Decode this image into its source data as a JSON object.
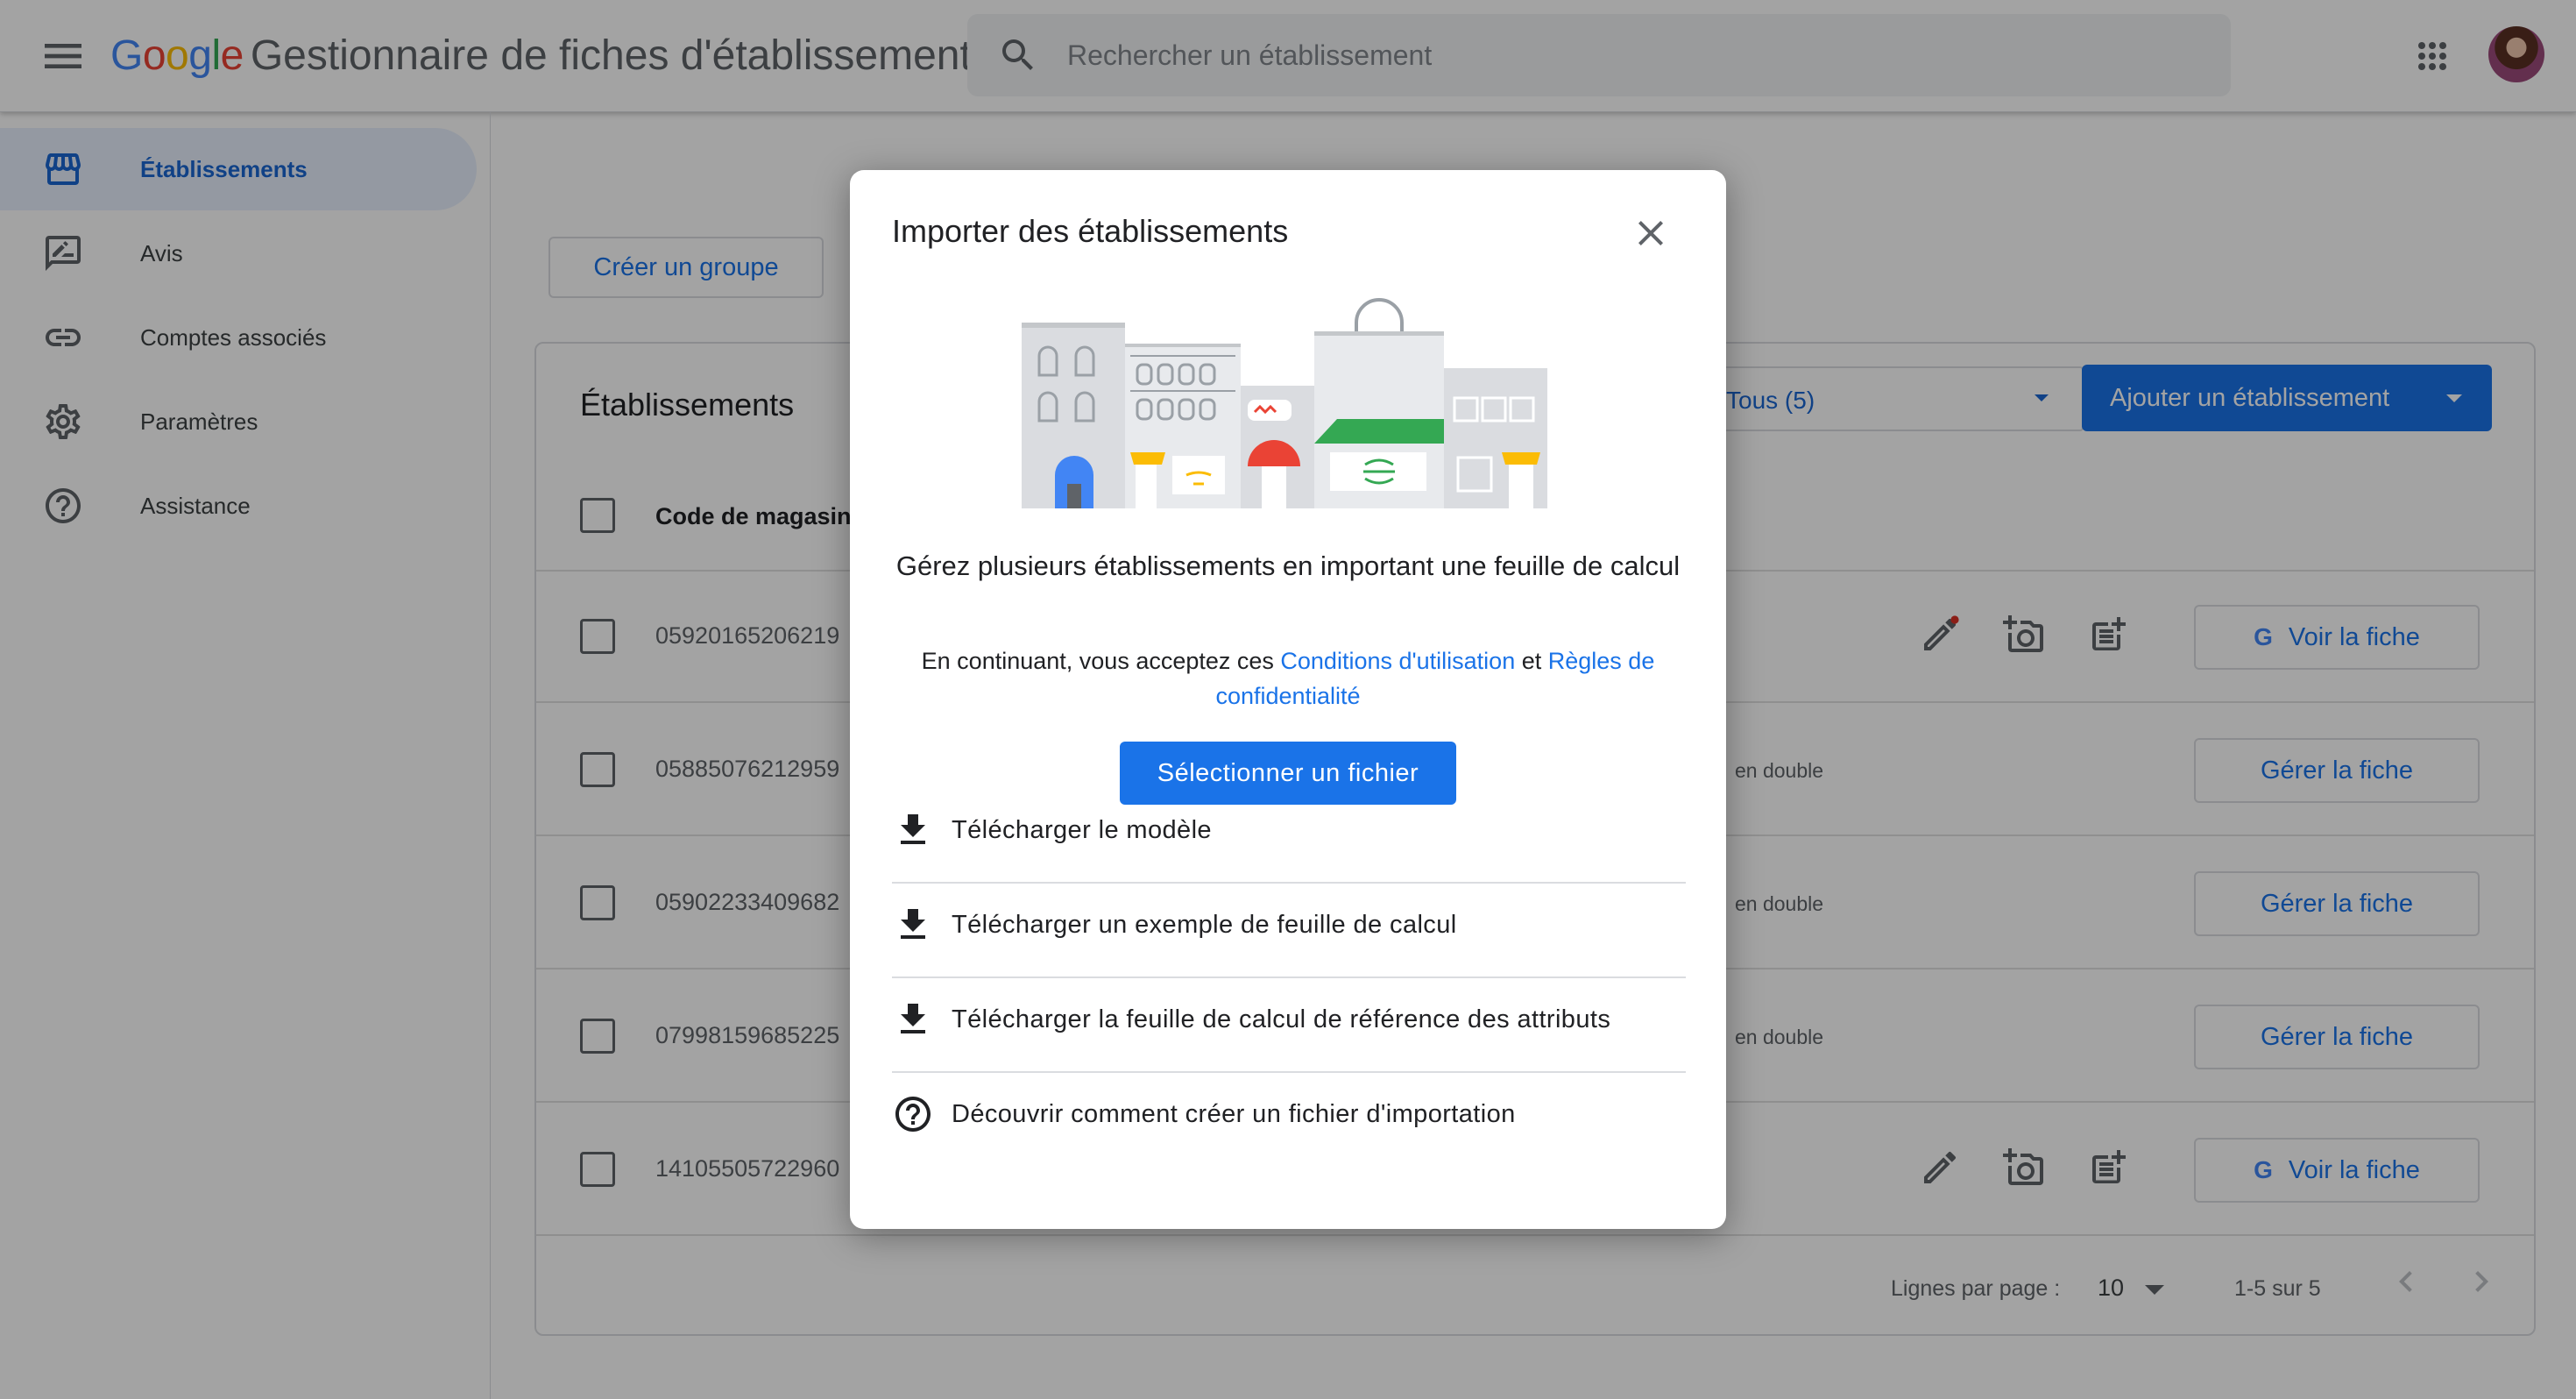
{
  "header": {
    "logo_google": [
      "G",
      "o",
      "o",
      "g",
      "l",
      "e"
    ],
    "product_name": "Gestionnaire de fiches d'établissement",
    "search_placeholder": "Rechercher un établissement"
  },
  "sidebar": {
    "items": [
      {
        "label": "Établissements",
        "icon": "storefront-icon",
        "active": true
      },
      {
        "label": "Avis",
        "icon": "reviews-icon",
        "active": false
      },
      {
        "label": "Comptes associés",
        "icon": "link-icon",
        "active": false
      },
      {
        "label": "Paramètres",
        "icon": "gear-icon",
        "active": false
      },
      {
        "label": "Assistance",
        "icon": "help-icon",
        "active": false
      }
    ]
  },
  "main": {
    "create_group_label": "Créer un groupe",
    "card_title": "Établissements",
    "filter_value": "Tous (5)",
    "add_button_label": "Ajouter un établissement",
    "column_header": "Code de magasin",
    "rows": [
      {
        "code": "05920165206219",
        "status": "",
        "button": "Voir la fiche",
        "button_type": "view",
        "edit_notification": true
      },
      {
        "code": "05885076212959",
        "status": "en double",
        "button": "Gérer la fiche",
        "button_type": "manage"
      },
      {
        "code": "05902233409682",
        "status": "en double",
        "button": "Gérer la fiche",
        "button_type": "manage"
      },
      {
        "code": "07998159685225",
        "status": "en double",
        "button": "Gérer la fiche",
        "button_type": "manage"
      },
      {
        "code": "14105505722960",
        "status": "",
        "button": "Voir la fiche",
        "button_type": "view",
        "edit_notification": false
      }
    ],
    "pager": {
      "rows_label": "Lignes par page :",
      "rows_value": "10",
      "range": "1-5 sur 5"
    }
  },
  "dialog": {
    "title": "Importer des établissements",
    "heading": "Gérez plusieurs établissements en important une feuille de calcul",
    "terms_prefix": "En continuant, vous acceptez ces ",
    "terms_link": "Conditions d'utilisation",
    "terms_and": " et ",
    "privacy_link": "Règles de confidentialité",
    "select_button": "Sélectionner un fichier",
    "items": [
      {
        "label": "Télécharger le modèle",
        "icon": "download-icon"
      },
      {
        "label": "Télécharger un exemple de feuille de calcul",
        "icon": "download-icon"
      },
      {
        "label": "Télécharger la feuille de calcul de référence des attributs",
        "icon": "download-icon"
      },
      {
        "label": "Découvrir comment créer un fichier d'importation",
        "icon": "help-circle-icon"
      }
    ]
  },
  "colors": {
    "accent": "#1a73e8",
    "active_nav_bg": "#e8f0fe",
    "notification_dot": "#d93025"
  }
}
